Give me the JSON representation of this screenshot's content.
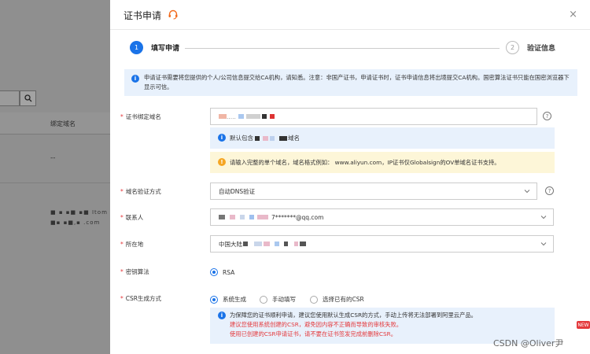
{
  "background": {
    "column_header": "绑定域名",
    "row_dash": "--",
    "row_masked_1": "■ ▪ ▪■ ▪■ Itom",
    "row_masked_2": "■▪ ▪■,▪ .com"
  },
  "drawer": {
    "title": "证书申请",
    "close_glyph": "×",
    "steps": [
      {
        "number": "1",
        "label": "填写申请"
      },
      {
        "number": "2",
        "label": "验证信息"
      }
    ],
    "notice": "申请证书需要将您提供的个人/公司信息提交给CA机构，请知悉。注意：非国产证书，申请证书时，证书申请信息将出境提交CA机构。国密算法证书只能在国密浏览器下显示可信。",
    "form": {
      "domain_label": "证书绑定域名",
      "domain_value": ".....",
      "domain_info": "默认包含",
      "domain_info_suffix": "域名",
      "domain_warning": "请输入完整的单个域名，域名格式例如： www.aliyun.com，IP证书仅Globalsign的OV单域名证书支持。",
      "verify_label": "域名验证方式",
      "verify_value": "自动DNS验证",
      "contact_label": "联系人",
      "contact_value": "7*******@qq.com",
      "location_label": "所在地",
      "location_value": "中国大陆",
      "algo_label": "密钥算法",
      "algo_option": "RSA",
      "csr_label": "CSR生成方式",
      "csr_options": [
        "系统生成",
        "手动填写",
        "选择已有的CSR"
      ],
      "csr_info": "为保障您的证书顺利申请，建议您使用默认生成CSR的方式，手动上传将无法部署到阿里云产品。",
      "csr_red_1": "建议您使用系统创建的CSR，避免因内容不正确而导致的审核失败。",
      "csr_red_2": "使用已创建的CSR申请证书，请不要在证书签发完成前删除CSR。"
    }
  },
  "watermark": "CSDN @Oliver尹",
  "new_badge": "NEW",
  "colors": {
    "primary": "#1a73e8",
    "red": "#e4393c",
    "warning": "#f5a623"
  }
}
